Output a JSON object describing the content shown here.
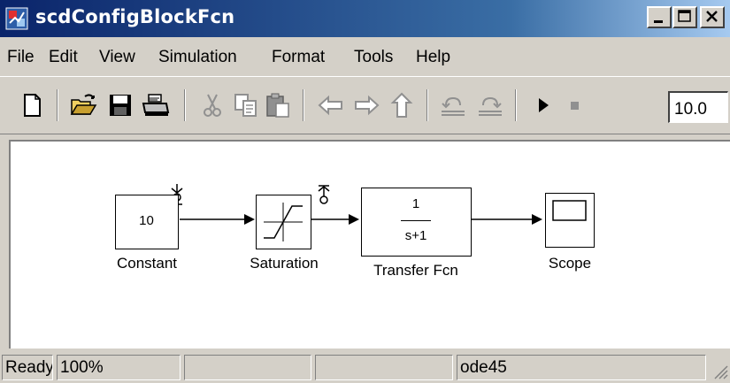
{
  "window": {
    "title": "scdConfigBlockFcn"
  },
  "menu": [
    "File",
    "Edit",
    "View",
    "Simulation",
    "Format",
    "Tools",
    "Help"
  ],
  "toolbar": {
    "stop_time": "10.0"
  },
  "blocks": {
    "constant": {
      "value": "10",
      "label": "Constant"
    },
    "saturation": {
      "label": "Saturation"
    },
    "transfer_fcn": {
      "numerator": "1",
      "denominator": "s+1",
      "label": "Transfer Fcn"
    },
    "scope": {
      "label": "Scope"
    }
  },
  "status": {
    "ready": "Ready",
    "zoom": "100%",
    "solver": "ode45"
  },
  "colors": {
    "title_start": "#0a246a",
    "title_end": "#a6caf0",
    "face": "#d4d0c8"
  }
}
